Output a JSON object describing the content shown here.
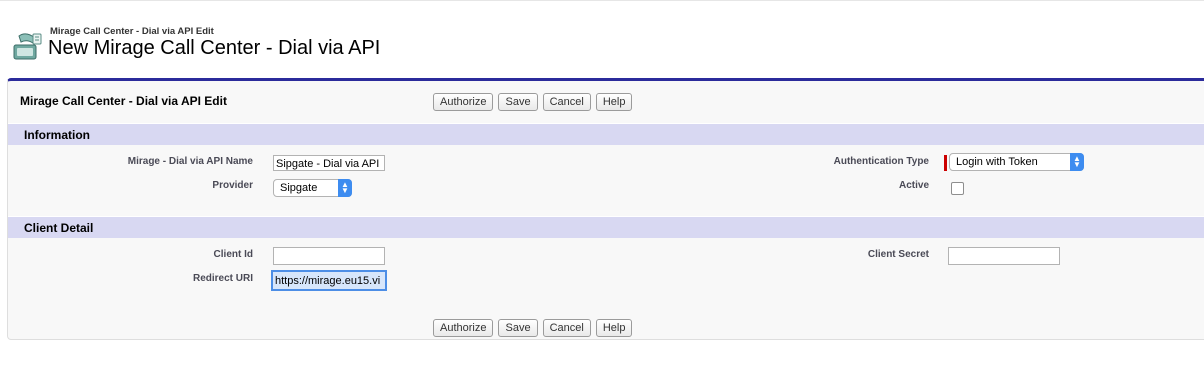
{
  "header": {
    "subtitle": "Mirage Call Center - Dial via API Edit",
    "title": "New Mirage Call Center - Dial via API",
    "icon": "call-center-icon"
  },
  "panel": {
    "title": "Mirage Call Center - Dial via API Edit",
    "buttons": {
      "authorize": "Authorize",
      "save": "Save",
      "cancel": "Cancel",
      "help": "Help"
    }
  },
  "sections": {
    "information": {
      "title": "Information",
      "name_label": "Mirage - Dial via API Name",
      "name_value": "Sipgate - Dial via API",
      "provider_label": "Provider",
      "provider_value": "Sipgate",
      "auth_type_label": "Authentication Type",
      "auth_type_value": "Login with Token",
      "active_label": "Active",
      "active_checked": false
    },
    "client_detail": {
      "title": "Client Detail",
      "client_id_label": "Client Id",
      "client_id_value": "",
      "client_secret_label": "Client Secret",
      "client_secret_value": "",
      "redirect_uri_label": "Redirect URI",
      "redirect_uri_value": "https://mirage.eu15.vi"
    }
  },
  "colors": {
    "accent_border": "#2b2b9b",
    "section_header": "#d8d8f2",
    "select_arrow": "#3d8cf0",
    "required": "#cc0000",
    "focus": "#4d8ee6"
  }
}
